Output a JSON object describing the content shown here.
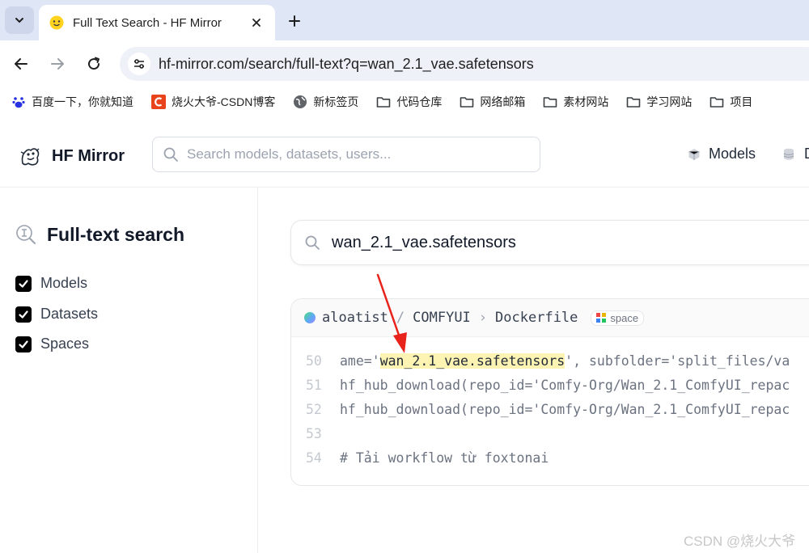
{
  "browser": {
    "tab_title": "Full Text Search - HF Mirror",
    "url": "hf-mirror.com/search/full-text?q=wan_2.1_vae.safetensors",
    "bookmarks": [
      {
        "label": "百度一下，你就知道",
        "icon": "baidu-paw-icon"
      },
      {
        "label": "烧火大爷-CSDN博客",
        "icon": "csdn-icon"
      },
      {
        "label": "新标签页",
        "icon": "globe-icon"
      },
      {
        "label": "代码仓库",
        "icon": "folder-icon"
      },
      {
        "label": "网络邮箱",
        "icon": "folder-icon"
      },
      {
        "label": "素材网站",
        "icon": "folder-icon"
      },
      {
        "label": "学习网站",
        "icon": "folder-icon"
      },
      {
        "label": "项目",
        "icon": "folder-icon"
      }
    ]
  },
  "header": {
    "brand": "HF Mirror",
    "search_placeholder": "Search models, datasets, users...",
    "nav": {
      "models": "Models",
      "datasets": "D"
    }
  },
  "sidebar": {
    "title": "Full-text search",
    "filters": [
      {
        "label": "Models",
        "checked": true
      },
      {
        "label": "Datasets",
        "checked": true
      },
      {
        "label": "Spaces",
        "checked": true
      }
    ]
  },
  "main": {
    "query": "wan_2.1_vae.safetensors",
    "result": {
      "owner": "aloatist",
      "repo": "COMFYUI",
      "file": "Dockerfile",
      "badge": "space",
      "lines": [
        {
          "no": "50",
          "pre": "ame='",
          "hl": "wan_2.1_vae.safetensors",
          "post": "', subfolder='split_files/va"
        },
        {
          "no": "51",
          "pre": "hf_hub_download(repo_id='Comfy-Org/Wan_2.1_ComfyUI_repac",
          "hl": "",
          "post": ""
        },
        {
          "no": "52",
          "pre": "hf_hub_download(repo_id='Comfy-Org/Wan_2.1_ComfyUI_repac",
          "hl": "",
          "post": ""
        },
        {
          "no": "53",
          "pre": "",
          "hl": "",
          "post": ""
        },
        {
          "no": "54",
          "pre": "# Tải workflow từ foxtonai",
          "hl": "",
          "post": ""
        }
      ]
    }
  },
  "watermark": "CSDN @烧火大爷",
  "colors": {
    "highlight": "#fdf3b3",
    "annotation_arrow": "#e8231b",
    "checkbox": "#000000"
  }
}
